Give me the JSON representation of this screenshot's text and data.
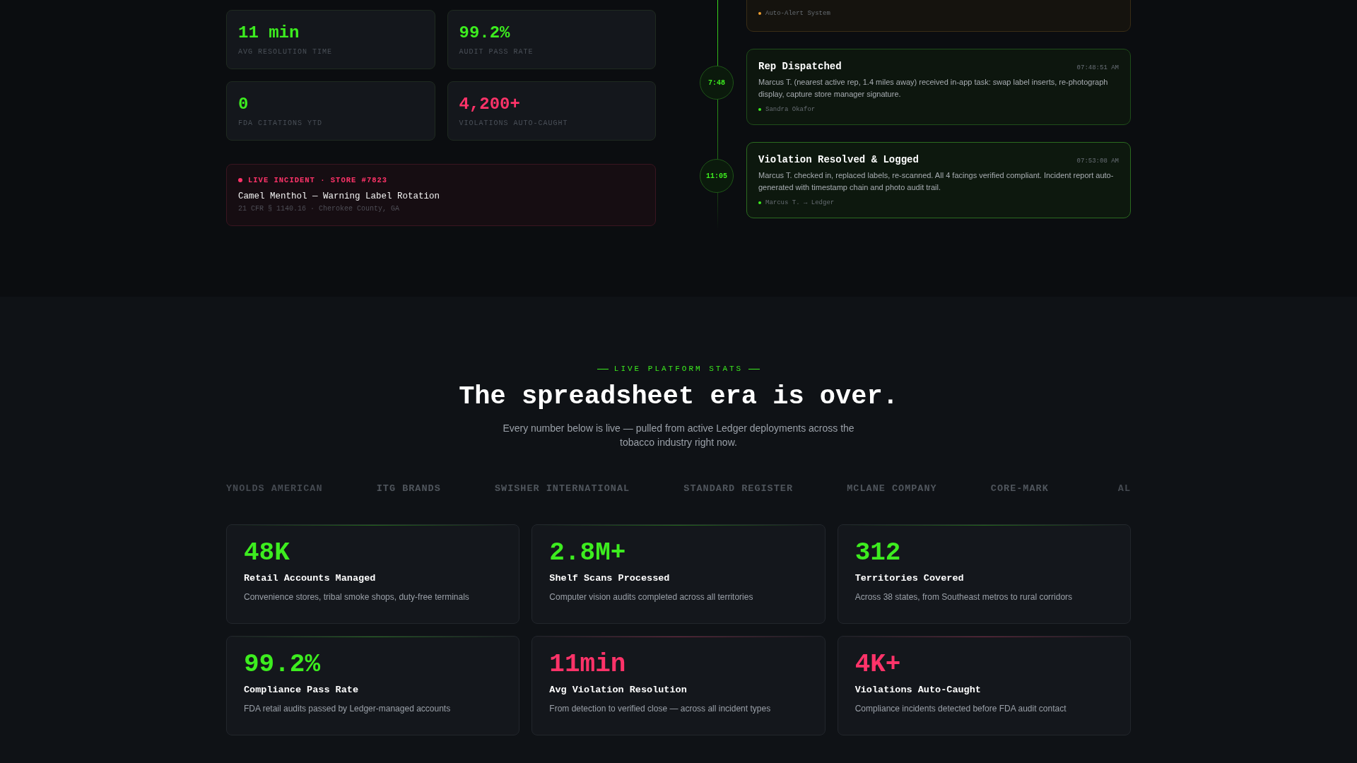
{
  "metrics": [
    {
      "value": "11 min",
      "label": "AVG RESOLUTION TIME",
      "color": "#3ded1f"
    },
    {
      "value": "99.2%",
      "label": "AUDIT PASS RATE",
      "color": "#3ded1f"
    },
    {
      "value": "0",
      "label": "FDA CITATIONS YTD",
      "color": "#3ded1f"
    },
    {
      "value": "4,200+",
      "label": "VIOLATIONS AUTO-CAUGHT",
      "color": "#ff3369"
    }
  ],
  "incident": {
    "tag": "LIVE INCIDENT · STORE #7823",
    "title": "Camel Menthol — Warning Label Rotation",
    "meta": "21 CFR § 1140.16 · Cherokee County, GA"
  },
  "timeline": [
    {
      "kind": "alert",
      "author": "Auto-Alert System",
      "color": "#f0a030"
    },
    {
      "kind": "action",
      "time": "7:48",
      "title": "Rep Dispatched",
      "stamp": "07:48:51 AM",
      "body": "Marcus T. (nearest active rep, 1.4 miles away) received in-app task: swap label inserts, re-photograph display, capture store manager signature.",
      "author": "Sandra Okafor",
      "color": "#3ded1f"
    },
    {
      "kind": "resolved",
      "time": "11:05",
      "title": "Violation Resolved & Logged",
      "stamp": "07:53:08 AM",
      "body": "Marcus T. checked in, replaced labels, re-scanned. All 4 facings verified compliant. Incident report auto-generated with timestamp chain and photo audit trail.",
      "author": "Marcus T. → Ledger",
      "color": "#3ded1f"
    }
  ],
  "stats_section": {
    "eyebrow": "LIVE PLATFORM STATS",
    "heading": "The spreadsheet era is over.",
    "subtitle": "Every number below is live — pulled from active Ledger deployments across the tobacco industry right now.",
    "brands": [
      "YNOLDS AMERICAN",
      "ITG BRANDS",
      "SWISHER INTERNATIONAL",
      "STANDARD REGISTER",
      "MCLANE COMPANY",
      "CORE-MARK",
      "AL"
    ],
    "cards": [
      {
        "value": "48K",
        "title": "Retail Accounts Managed",
        "desc": "Convenience stores, tribal smoke shops, duty-free terminals",
        "color": "#3ded1f"
      },
      {
        "value": "2.8M+",
        "title": "Shelf Scans Processed",
        "desc": "Computer vision audits completed across all territories",
        "color": "#3ded1f"
      },
      {
        "value": "312",
        "title": "Territories Covered",
        "desc": "Across 38 states, from Southeast metros to rural corridors",
        "color": "#3ded1f"
      },
      {
        "value": "99.2%",
        "title": "Compliance Pass Rate",
        "desc": "FDA retail audits passed by Ledger-managed accounts",
        "color": "#3ded1f"
      },
      {
        "value": "11min",
        "title": "Avg Violation Resolution",
        "desc": "From detection to verified close — across all incident types",
        "color": "#ff3369"
      },
      {
        "value": "4K+",
        "title": "Violations Auto-Caught",
        "desc": "Compliance incidents detected before FDA audit contact",
        "color": "#ff3369"
      }
    ]
  }
}
